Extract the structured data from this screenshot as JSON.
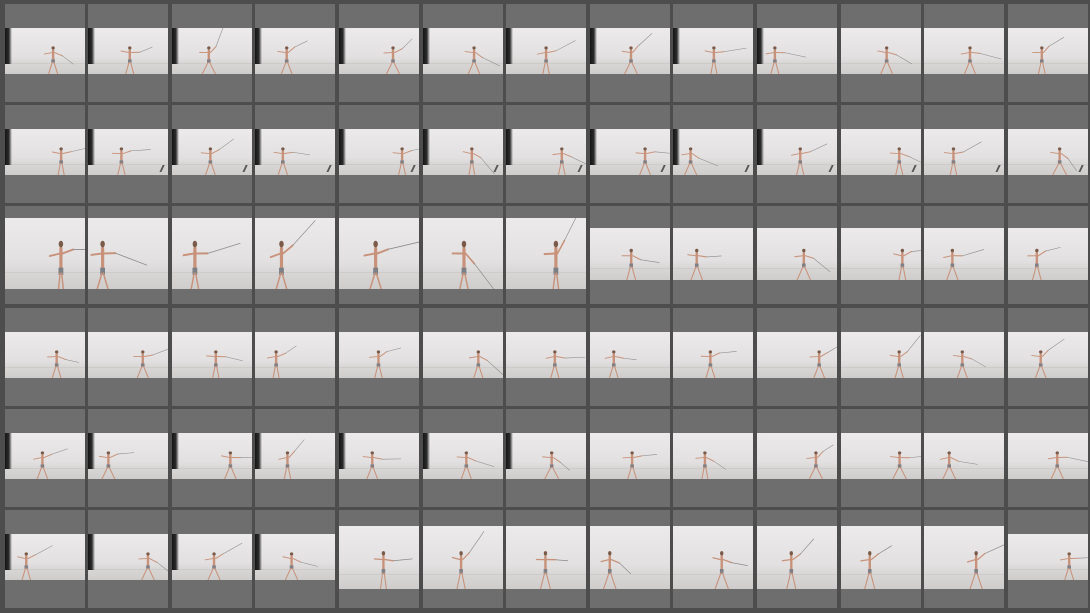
{
  "sheet": {
    "columns": 13,
    "rows": 6,
    "colors": {
      "background": "#4d4d4d",
      "cell": "#6e6e6e",
      "studio_wall": "#e6e4e4",
      "studio_floor": "#d2d0cf",
      "skin": "#c8927a",
      "shorts": "#7d7f86",
      "sword": "#8a8a8a",
      "backdrop_edge": "#1a1a1a"
    },
    "icons": [
      "frame-thumbnail-icon",
      "fencer-figure-icon",
      "sword-icon"
    ],
    "frames_per_row": [
      13,
      13,
      13,
      13,
      13,
      13
    ],
    "large_frames": {
      "row": 3,
      "count": 7
    }
  }
}
